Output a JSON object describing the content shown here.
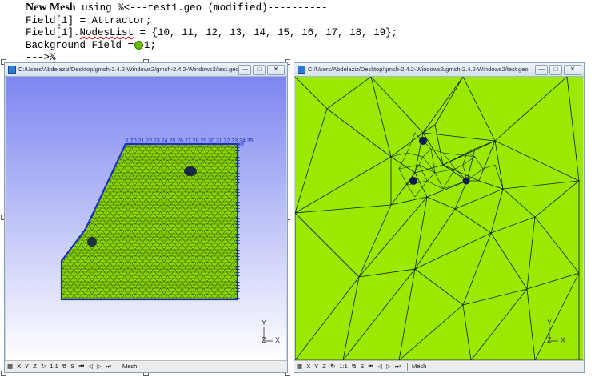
{
  "code": {
    "keyword": "New Mesh",
    "line1_rest": " using %<---test1.geo (modified)----------",
    "line2": "Field[1] = Attractor;",
    "line3_prefix": "Field[1].",
    "line3_squig": "NodesList",
    "line3_rest": " = {10, 11, 12, 13, 14, 15, 16, 17, 18, 19};",
    "line4_prefix": "Background Field =",
    "line4_rest": "1;",
    "line5": "--->%"
  },
  "left_window": {
    "title": "C:/Users/Abdelaziz/Desktop/gmsh-2.4.2-Windows2/gmsh-2.4.2-Windows2/test.geo",
    "mesh_color": "#8cd600",
    "node_label_top": "1 20 21 22 23 24 25 26 27 28 29 30 31 32 33 34 35",
    "node_label_right": "89"
  },
  "right_window": {
    "title": "C:/Users/Abdelaziz/Desktop/gmsh-2.4.2-Windows2/gmsh-2.4.2-Windows2/test.geo",
    "fill_color": "#9be800"
  },
  "statusbar": {
    "x": "X",
    "y": "Y",
    "z": "Z",
    "ratio": "1:1",
    "s": "S",
    "mesh": "Mesh"
  },
  "axis": {
    "z": "Z",
    "x": "X",
    "y": "Y"
  },
  "window_buttons": {
    "minimize": "—",
    "maximize": "□",
    "close": "✕"
  }
}
